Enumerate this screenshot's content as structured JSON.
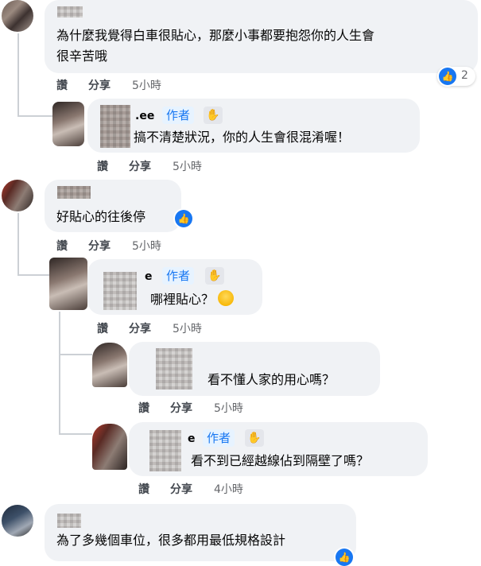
{
  "comments": [
    {
      "text_line1": "為什麼我覺得白車很貼心，那麼小事都要抱怨你的人生會",
      "text_line2": "很辛苦哦",
      "actions": {
        "like": "讚",
        "reply": "分享",
        "time": "5小時"
      },
      "reactions": {
        "count": "2"
      }
    },
    {
      "name": ".ee",
      "author_badge": "作者",
      "text": "搞不清楚狀況，你的人生會很混淆喔！",
      "actions": {
        "like": "讚",
        "reply": "分享",
        "time": "5小時"
      }
    },
    {
      "text": "好貼心的往後停",
      "actions": {
        "like": "讚",
        "reply": "分享",
        "time": "5小時"
      }
    },
    {
      "name": "e",
      "author_badge": "作者",
      "text": "哪裡貼心？",
      "actions": {
        "like": "讚",
        "reply": "分享",
        "time": "5小時"
      }
    },
    {
      "text": "看不懂人家的用心嗎？",
      "actions": {
        "like": "讚",
        "reply": "分享",
        "time": "5小時"
      }
    },
    {
      "name": "e",
      "author_badge": "作者",
      "text": "看不到已經越線佔到隔壁了嗎？",
      "actions": {
        "like": "讚",
        "reply": "分享",
        "time": "4小時"
      }
    },
    {
      "text": "為了多幾個車位，很多都用最低規格設計"
    }
  ],
  "icons": {
    "like": "like-thumb-icon",
    "wave": "wave-hand-icon",
    "laugh": "laughing-emoji-icon"
  },
  "colors": {
    "bubble": "#f0f2f5",
    "accent": "#1877f2",
    "badge_bg": "#e7f3ff"
  }
}
